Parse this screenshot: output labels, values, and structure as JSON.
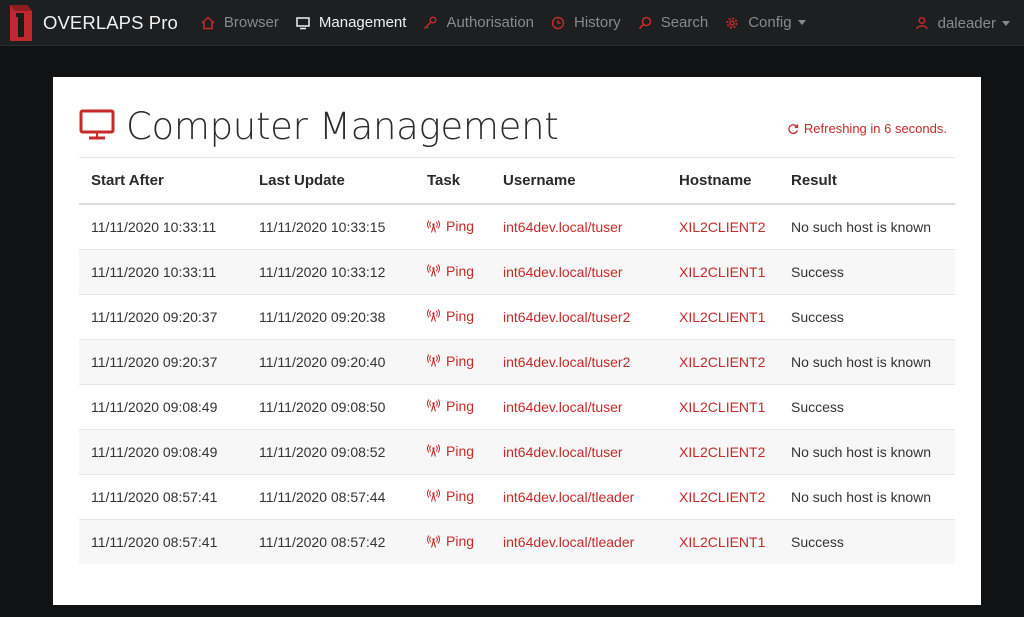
{
  "app": {
    "name": "OVERLAPS Pro"
  },
  "nav": {
    "items": [
      {
        "label": "Browser",
        "icon": "home-icon",
        "active": false
      },
      {
        "label": "Management",
        "icon": "monitor-icon",
        "active": true
      },
      {
        "label": "Authorisation",
        "icon": "key-icon",
        "active": false
      },
      {
        "label": "History",
        "icon": "clock-icon",
        "active": false
      },
      {
        "label": "Search",
        "icon": "search-icon",
        "active": false
      },
      {
        "label": "Config",
        "icon": "gear-icon",
        "active": false,
        "dropdown": true
      }
    ],
    "user": {
      "label": "daleader",
      "icon": "user-icon"
    }
  },
  "page": {
    "title": "Computer Management",
    "refresh_text": "Refreshing in 6 seconds."
  },
  "table": {
    "columns": [
      "Start After",
      "Last Update",
      "Task",
      "Username",
      "Hostname",
      "Result"
    ],
    "rows": [
      {
        "start": "11/11/2020 10:33:11",
        "updated": "11/11/2020 10:33:15",
        "task": "Ping",
        "username": "int64dev.local/tuser",
        "hostname": "XIL2CLIENT2",
        "result": "No such host is known"
      },
      {
        "start": "11/11/2020 10:33:11",
        "updated": "11/11/2020 10:33:12",
        "task": "Ping",
        "username": "int64dev.local/tuser",
        "hostname": "XIL2CLIENT1",
        "result": "Success"
      },
      {
        "start": "11/11/2020 09:20:37",
        "updated": "11/11/2020 09:20:38",
        "task": "Ping",
        "username": "int64dev.local/tuser2",
        "hostname": "XIL2CLIENT1",
        "result": "Success"
      },
      {
        "start": "11/11/2020 09:20:37",
        "updated": "11/11/2020 09:20:40",
        "task": "Ping",
        "username": "int64dev.local/tuser2",
        "hostname": "XIL2CLIENT2",
        "result": "No such host is known"
      },
      {
        "start": "11/11/2020 09:08:49",
        "updated": "11/11/2020 09:08:50",
        "task": "Ping",
        "username": "int64dev.local/tuser",
        "hostname": "XIL2CLIENT1",
        "result": "Success"
      },
      {
        "start": "11/11/2020 09:08:49",
        "updated": "11/11/2020 09:08:52",
        "task": "Ping",
        "username": "int64dev.local/tuser",
        "hostname": "XIL2CLIENT2",
        "result": "No such host is known"
      },
      {
        "start": "11/11/2020 08:57:41",
        "updated": "11/11/2020 08:57:44",
        "task": "Ping",
        "username": "int64dev.local/tleader",
        "hostname": "XIL2CLIENT2",
        "result": "No such host is known"
      },
      {
        "start": "11/11/2020 08:57:41",
        "updated": "11/11/2020 08:57:42",
        "task": "Ping",
        "username": "int64dev.local/tleader",
        "hostname": "XIL2CLIENT1",
        "result": "Success"
      }
    ]
  },
  "colors": {
    "accent": "#c72a2a",
    "navbar": "#1e1f21",
    "background": "#111213"
  }
}
